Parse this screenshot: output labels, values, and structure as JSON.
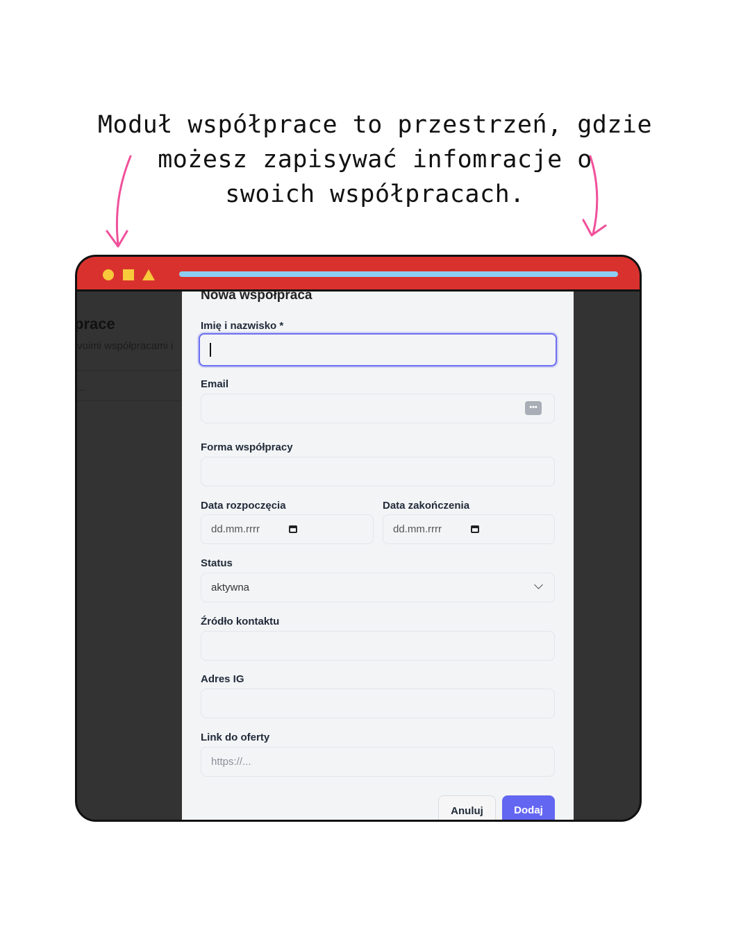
{
  "caption": {
    "line1": "Moduł współprace to przestrzeń, gdzie",
    "line2": "możesz zapisywać infomracje o",
    "line3": "swoich współpracach."
  },
  "background_page": {
    "title_fragment": "prace",
    "subtitle_fragment": "voimi współpracami i",
    "search_fragment": "..."
  },
  "modal": {
    "title": "Nowa współpraca",
    "fields": {
      "name": {
        "label": "Imię i nazwisko *",
        "value": ""
      },
      "email": {
        "label": "Email",
        "value": ""
      },
      "form": {
        "label": "Forma współpracy",
        "value": ""
      },
      "start_date": {
        "label": "Data rozpoczęcia",
        "placeholder": "dd.mm.rrrr"
      },
      "end_date": {
        "label": "Data zakończenia",
        "placeholder": "dd.mm.rrrr"
      },
      "status": {
        "label": "Status",
        "value": "aktywna"
      },
      "source": {
        "label": "Źródło kontaktu",
        "value": ""
      },
      "ig": {
        "label": "Adres IG",
        "value": ""
      },
      "link": {
        "label": "Link do oferty",
        "placeholder": "https://..."
      }
    },
    "buttons": {
      "cancel": "Anuluj",
      "add": "Dodaj"
    }
  },
  "colors": {
    "titlebar": "#d9322e",
    "accent": "#6366f1",
    "arrow": "#f0509a",
    "window_controls": "#f7c93b",
    "address_bar": "#8ecef2"
  }
}
